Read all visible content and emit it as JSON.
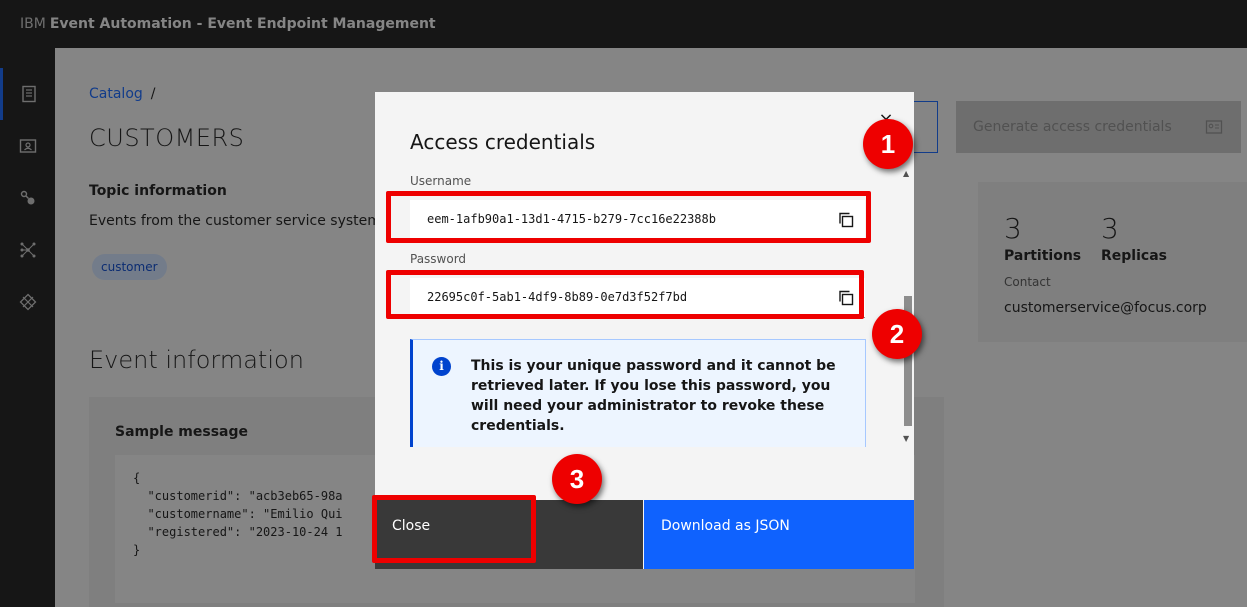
{
  "header": {
    "brand": "IBM",
    "product": "Event Automation - Event Endpoint Management"
  },
  "sidenav": {
    "icons": [
      "catalog-icon",
      "subscriptions-icon",
      "topics-icon",
      "gateways-icon",
      "admin-icon"
    ]
  },
  "breadcrumb": {
    "link": "Catalog",
    "separator": "/"
  },
  "topic": {
    "title": "CUSTOMERS",
    "info_heading": "Topic information",
    "description": "Events from the customer service system",
    "tag": "customer"
  },
  "event_info": {
    "heading": "Event information",
    "sample_title": "Sample message",
    "code_lines": [
      "{",
      "  \"customerid\": \"acb3eb65-98a",
      "  \"customername\": \"Emilio Qui",
      "  \"registered\": \"2023-10-24 1",
      "}"
    ]
  },
  "generate_button": {
    "label": "Generate access credentials"
  },
  "stats": {
    "partitions_value": "3",
    "partitions_label": "Partitions",
    "replicas_value": "3",
    "replicas_label": "Replicas",
    "contact_label": "Contact",
    "contact_value": "customerservice@focus.corp"
  },
  "modal": {
    "title": "Access credentials",
    "close_glyph": "×",
    "username_label": "Username",
    "username_value": "eem-1afb90a1-13d1-4715-b279-7cc16e22388b",
    "password_label": "Password",
    "password_value": "22695c0f-5ab1-4df9-8b89-0e7d3f52f7bd",
    "notice": "This is your unique password and it cannot be retrieved later. If you lose this password, you will need your administrator to revoke these credentials.",
    "close_button": "Close",
    "download_button": "Download as JSON"
  },
  "annotations": {
    "badge_1": "1",
    "badge_2": "2",
    "badge_3": "3",
    "color": "#ee0000"
  }
}
